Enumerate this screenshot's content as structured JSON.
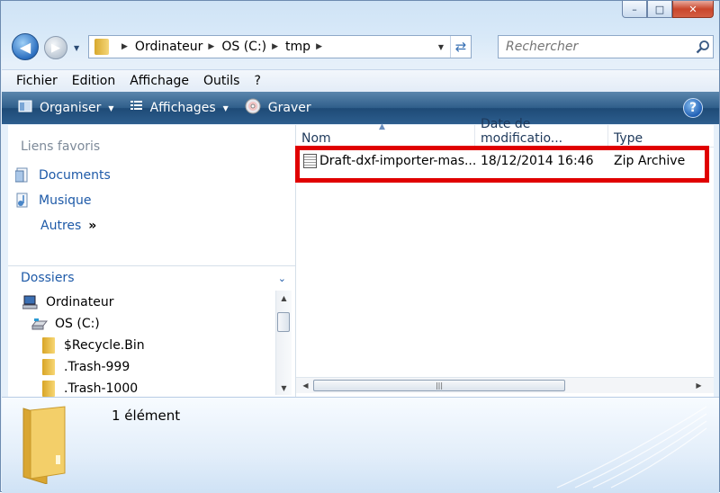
{
  "window": {
    "caption_buttons": {
      "minimize": "–",
      "maximize": "□",
      "close": "✕"
    }
  },
  "nav": {
    "back_icon": "◀",
    "forward_icon": "▶",
    "dropdown_icon": "▼"
  },
  "address": {
    "crumbs": [
      "Ordinateur",
      "OS (C:)",
      "tmp"
    ],
    "sep": "▶",
    "dropdown": "▼",
    "refresh": "⇄"
  },
  "search": {
    "placeholder": "Rechercher"
  },
  "menu": {
    "items": [
      "Fichier",
      "Edition",
      "Affichage",
      "Outils",
      "?"
    ]
  },
  "commands": {
    "organise": "Organiser",
    "views": "Affichages",
    "burn": "Graver",
    "arrow": "▼",
    "help": "?"
  },
  "left": {
    "favorites_title": "Liens favoris",
    "favorites": [
      "Documents",
      "Musique"
    ],
    "more": "Autres",
    "more_arrows": "»",
    "folders_title": "Dossiers",
    "folders_chevron": "⌄",
    "tree": [
      "Ordinateur",
      "OS (C:)",
      "$Recycle.Bin",
      ".Trash-999",
      ".Trash-1000"
    ],
    "scroll_up": "▲",
    "scroll_down": "▼"
  },
  "files": {
    "columns": [
      "Nom",
      "Date de modificatio...",
      "Type"
    ],
    "sort_indicator": "▲",
    "rows": [
      {
        "name": "Draft-dxf-importer-mas...",
        "date": "18/12/2014 16:46",
        "type": "Zip Archive"
      }
    ],
    "scroll_left": "◀",
    "scroll_right": "▶",
    "grip": "|||"
  },
  "details": {
    "count": "1 élément"
  },
  "colors": {
    "command_bar": "#2d5e8e",
    "highlight": "#e00000",
    "link": "#1e5aa8"
  }
}
